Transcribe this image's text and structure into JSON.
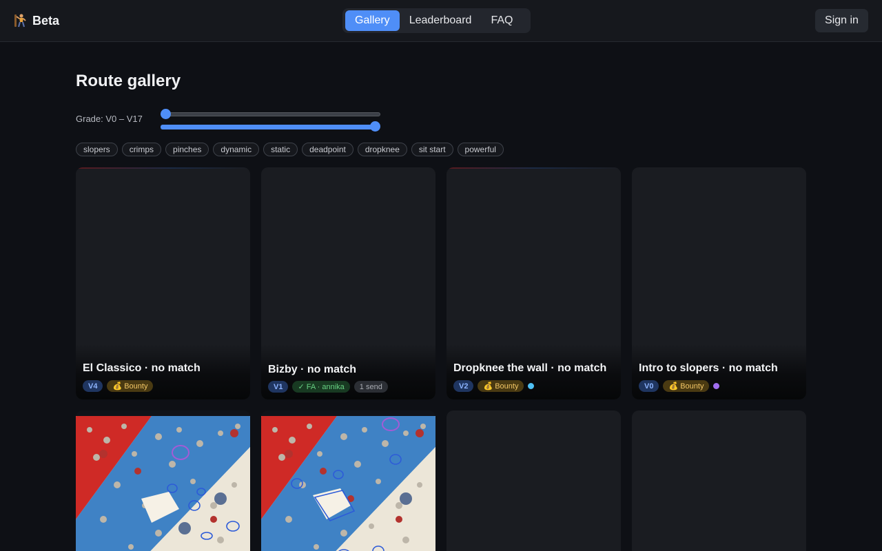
{
  "app": {
    "name": "Beta"
  },
  "nav": {
    "tabs": [
      "Gallery",
      "Leaderboard",
      "FAQ"
    ],
    "active": "Gallery"
  },
  "auth": {
    "signin_label": "Sign in"
  },
  "page": {
    "title": "Route gallery"
  },
  "filters": {
    "grade_label": "Grade: V0 – V17",
    "grade_min": 0,
    "grade_max": 17,
    "tags": [
      "slopers",
      "crimps",
      "pinches",
      "dynamic",
      "static",
      "deadpoint",
      "dropknee",
      "sit start",
      "powerful"
    ]
  },
  "colors": {
    "accent": "#4f8ef7",
    "bounty": "#f3c766",
    "fa": "#67d083",
    "dot_cyan": "#4fc1f5",
    "dot_purple": "#a06ef0"
  },
  "routes": [
    {
      "title": "El Classico · no match",
      "grade": "V4",
      "bounty": "💰 Bounty"
    },
    {
      "title": "Bizby · no match",
      "grade": "V1",
      "fa": "✓ FA · annika",
      "sends": "1 send"
    },
    {
      "title": "Dropknee the wall · no match",
      "grade": "V2",
      "bounty": "💰 Bounty"
    },
    {
      "title": "Intro to slopers · no match",
      "grade": "V0",
      "bounty": "💰 Bounty"
    }
  ]
}
